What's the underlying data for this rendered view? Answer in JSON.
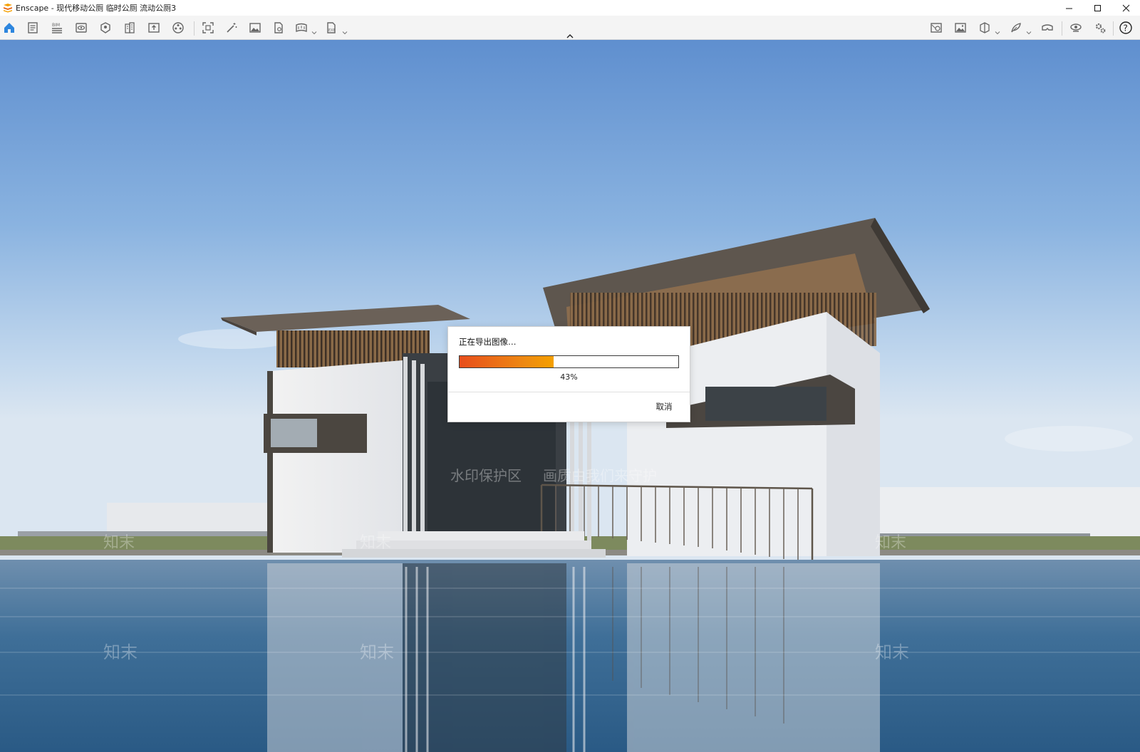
{
  "window": {
    "title": "Enscape - 现代移动公厕 临时公厕 流动公厕3",
    "logo_icon": "enscape-logo-icon",
    "controls": [
      "minimize-icon",
      "maximize-icon",
      "close-icon"
    ]
  },
  "toolbar": {
    "left_tools": [
      "home-icon",
      "document-icon",
      "bim-icon",
      "view-icon",
      "asset-library-icon",
      "building-icon",
      "upload-icon",
      "material-icon",
      "screenshot-icon",
      "magic-wand-icon",
      "image-icon",
      "file-export-icon",
      "panorama-icon",
      "exe-export-icon"
    ],
    "right_tools": [
      "map-icon",
      "gallery-icon",
      "cube-icon",
      "feather-icon",
      "vr-headset-icon",
      "visual-settings-icon",
      "settings-icon",
      "help-icon"
    ],
    "collapse_icon": "chevron-up-icon",
    "accent_color": "#2e86de"
  },
  "scene": {
    "description_icon": "rendered-scene",
    "watermark_texts": [
      "水印保护区",
      "画质由我们来守护",
      "知末"
    ]
  },
  "dialog": {
    "title": "正在导出图像…",
    "progress": 0.43,
    "progress_label": "43%",
    "cancel_label": "取消",
    "fill_colors": [
      "#e84e1c",
      "#f5a000"
    ]
  }
}
